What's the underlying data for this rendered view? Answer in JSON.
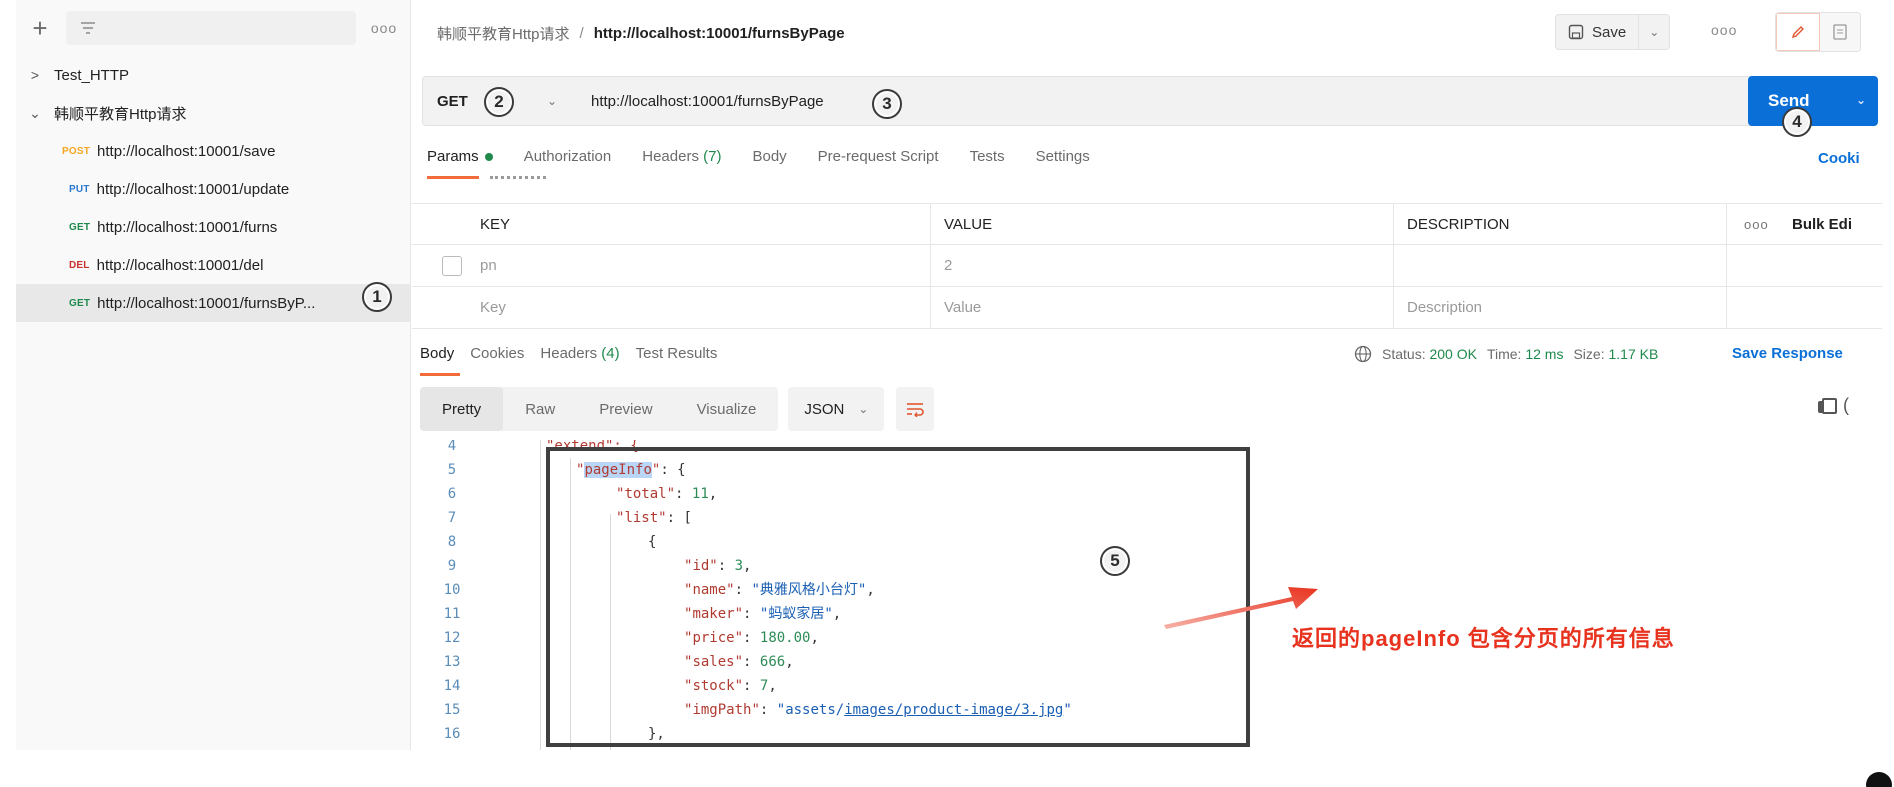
{
  "sidebar": {
    "collections": [
      {
        "label": "Test_HTTP",
        "expanded": false
      },
      {
        "label": "韩顺平教育Http请求",
        "expanded": true
      }
    ],
    "requests": [
      {
        "method": "POST",
        "url": "http://localhost:10001/save"
      },
      {
        "method": "PUT",
        "url": "http://localhost:10001/update"
      },
      {
        "method": "GET",
        "url": "http://localhost:10001/furns"
      },
      {
        "method": "DEL",
        "url": "http://localhost:10001/del"
      },
      {
        "method": "GET",
        "url": "http://localhost:10001/furnsByP..."
      }
    ]
  },
  "header": {
    "parent": "韩顺平教育Http请求",
    "separator": "/",
    "current": "http://localhost:10001/furnsByPage",
    "save_label": "Save"
  },
  "request": {
    "method": "GET",
    "url": "http://localhost:10001/furnsByPage",
    "send_label": "Send",
    "tabs": {
      "params": "Params",
      "authorization": "Authorization",
      "headers": "Headers",
      "headers_count": "(7)",
      "body": "Body",
      "prerequest": "Pre-request Script",
      "tests": "Tests",
      "settings": "Settings"
    },
    "cookies_link": "Cooki"
  },
  "params": {
    "headers": {
      "key": "KEY",
      "value": "VALUE",
      "description": "DESCRIPTION",
      "bulk": "Bulk Edi"
    },
    "rows": [
      {
        "key": "pn",
        "value": "2"
      }
    ],
    "placeholders": {
      "key": "Key",
      "value": "Value",
      "description": "Description"
    }
  },
  "response": {
    "tabs": {
      "body": "Body",
      "cookies": "Cookies",
      "headers": "Headers",
      "headers_count": "(4)",
      "test_results": "Test Results"
    },
    "status_label": "Status:",
    "status_value": "200 OK",
    "time_label": "Time:",
    "time_value": "12 ms",
    "size_label": "Size:",
    "size_value": "1.17 KB",
    "save_response": "Save Response",
    "format_modes": [
      "Pretty",
      "Raw",
      "Preview",
      "Visualize"
    ],
    "format": "JSON"
  },
  "code": {
    "line_numbers": [
      "4",
      "5",
      "6",
      "7",
      "8",
      "9",
      "10",
      "11",
      "12",
      "13",
      "14",
      "15",
      "16"
    ],
    "partial_first": "\"extend\": {",
    "key_pageInfo": "pageInfo",
    "key_total": "total",
    "val_total": "11",
    "key_list": "list",
    "key_id": "id",
    "val_id": "3",
    "key_name": "name",
    "val_name": "典雅风格小台灯",
    "key_maker": "maker",
    "val_maker": "蚂蚁家居",
    "key_price": "price",
    "val_price": "180.00",
    "key_sales": "sales",
    "val_sales": "666",
    "key_stock": "stock",
    "val_stock": "7",
    "key_imgPath": "imgPath",
    "val_img_a": "assets/",
    "val_img_b": "images/product-image/3.jpg"
  },
  "annotations": {
    "badges": [
      "1",
      "2",
      "3",
      "4",
      "5"
    ],
    "note": "返回的pageInfo 包含分页的所有信息"
  },
  "colors": {
    "accent_blue": "#0b6fd8",
    "active_underline": "#f26b3a",
    "annotation_red": "#e8321e",
    "get_green": "#1f8a4c",
    "post_orange": "#f5a623",
    "put_blue": "#2b78d1",
    "del_red": "#c9302c"
  }
}
